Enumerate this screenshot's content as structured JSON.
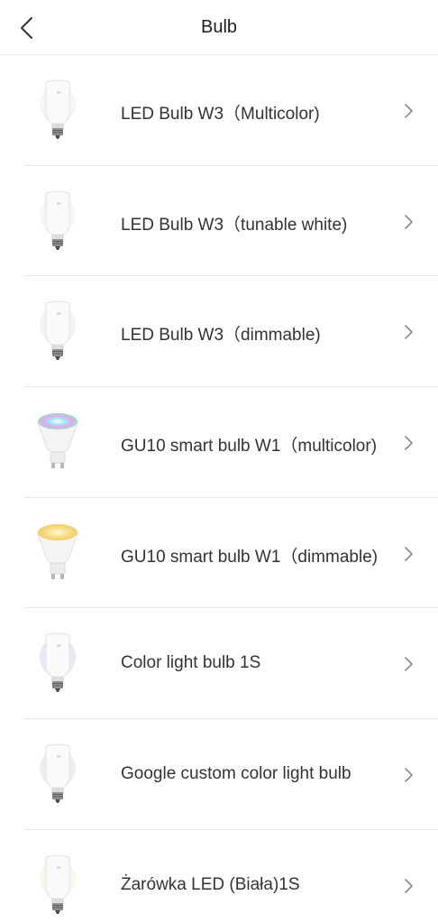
{
  "header": {
    "title": "Bulb",
    "back_icon": "chevron-left-icon"
  },
  "items": [
    {
      "label": "LED Bulb W3（Multicolor)",
      "icon": "a19-bulb-icon",
      "type": "a19",
      "glow": "#eceae4"
    },
    {
      "label": "LED Bulb W3（tunable white)",
      "icon": "a19-bulb-icon",
      "type": "a19",
      "glow": "#efeee9"
    },
    {
      "label": "LED Bulb W3（dimmable)",
      "icon": "a19-bulb-icon",
      "type": "a19",
      "glow": "#e7e7e7"
    },
    {
      "label": "GU10 smart bulb W1（multicolor)",
      "icon": "gu10-bulb-icon",
      "type": "gu10",
      "glow": "multicolor"
    },
    {
      "label": "GU10 smart bulb W1（dimmable)",
      "icon": "gu10-bulb-icon",
      "type": "gu10",
      "glow": "#f5d77a"
    },
    {
      "label": "Color light bulb 1S",
      "icon": "a19-bulb-icon",
      "type": "a19",
      "glow": "#d9c7e8"
    },
    {
      "label": "Google custom color light bulb",
      "icon": "a19-bulb-icon",
      "type": "a19",
      "glow": "#d6d7ee"
    },
    {
      "label": "Żarówka LED (Biała)1S",
      "icon": "a19-bulb-icon",
      "type": "a19",
      "glow": "#f4ecd4"
    }
  ],
  "chevron_icon": "chevron-right-icon"
}
